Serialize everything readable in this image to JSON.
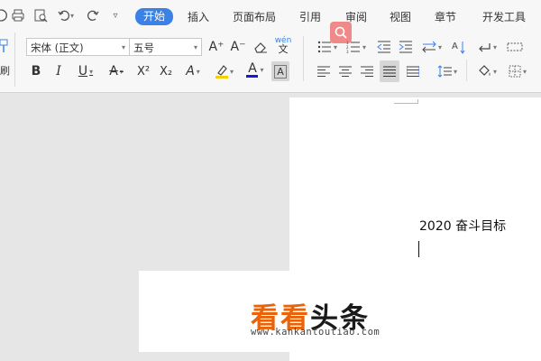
{
  "quick_access": {
    "icons": [
      "undo-icon",
      "print-icon",
      "print-preview-icon",
      "undo-arrow-icon",
      "redo-icon",
      "customize-icon"
    ]
  },
  "menu": {
    "tabs": [
      "开始",
      "插入",
      "页面布局",
      "引用",
      "审阅",
      "视图",
      "章节",
      "开发工具"
    ],
    "active": "开始"
  },
  "left_strip": {
    "label": "刷"
  },
  "font": {
    "family": "宋体 (正文)",
    "size": "五号"
  },
  "toolbar": {
    "grow_font": "A⁺",
    "shrink_font": "A⁻",
    "bold": "B",
    "italic": "I",
    "underline": "U",
    "strikethrough": "A",
    "superscript": "X²",
    "subscript": "X₂",
    "text_effect": "A",
    "font_color": "A",
    "char_shading": "A",
    "phonetic": "wén"
  },
  "colors": {
    "accent": "#3c82e6",
    "font_color_bar": "#1a1acc",
    "highlight_bar": "#f5d000",
    "watermark_orange": "#e8630a"
  },
  "document": {
    "text": "2020 奋斗目标"
  },
  "watermark": {
    "part1": "看看",
    "part2": "头条",
    "url": "www.kankantoutiao.com"
  }
}
